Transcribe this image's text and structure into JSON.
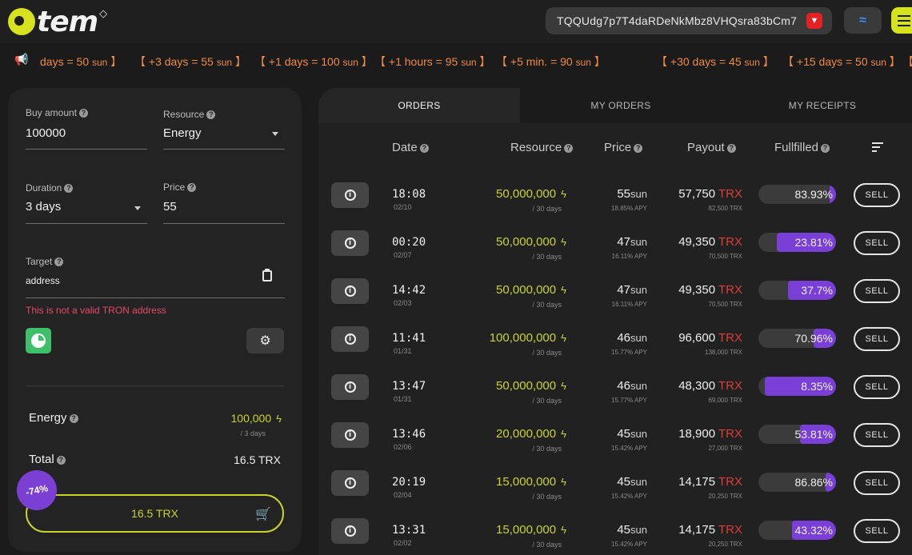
{
  "header": {
    "logo_text": "tem",
    "wallet_address": "TQQUdg7p7T4daRDeNkMbz8VHQsra83bCm7"
  },
  "ticker": [
    {
      "text": "days = 50 ",
      "unit": "sun",
      "end": " 】"
    },
    {
      "text": "【 +3 days = 55 ",
      "unit": "sun",
      "end": " 】"
    },
    {
      "text": "【 +1 days = 100 ",
      "unit": "sun",
      "end": " 】"
    },
    {
      "text": "【 +1 hours = 95 ",
      "unit": "sun",
      "end": " 】"
    },
    {
      "text": "【 +5 min. = 90 ",
      "unit": "sun",
      "end": " 】"
    },
    {
      "text": "【 +30 days = 45 ",
      "unit": "sun",
      "end": " 】"
    },
    {
      "text": "【 +15 days = 50 ",
      "unit": "sun",
      "end": " 】"
    },
    {
      "text": "【",
      "unit": "",
      "end": ""
    }
  ],
  "form": {
    "buy_amount_label": "Buy amount",
    "buy_amount_value": "100000",
    "resource_label": "Resource",
    "resource_value": "Energy",
    "duration_label": "Duration",
    "duration_value": "3 days",
    "price_label": "Price",
    "price_value": "55",
    "target_label": "Target",
    "target_value": "address",
    "error": "This is not a valid TRON address"
  },
  "summary": {
    "energy_label": "Energy",
    "energy_value": "100,000",
    "energy_sub": "/ 3 days",
    "total_label": "Total",
    "total_value": "16.5 TRX",
    "buy_button": "16.5 TRX",
    "discount": "-74%"
  },
  "tabs": [
    "ORDERS",
    "MY ORDERS",
    "MY RECEIPTS"
  ],
  "table": {
    "headers": [
      "Date",
      "Resource",
      "Price",
      "Payout",
      "Fullfilled"
    ],
    "rows": [
      {
        "time": "18:08",
        "date": "02/10",
        "resource": "50,000,000",
        "duration": "/ 30 days",
        "price": "55",
        "price_unit": "sun",
        "apy": "18.85% APY",
        "payout": "57,750",
        "payout_unit": "TRX",
        "payout_total": "82,500 TRX",
        "filled": "83.93%",
        "filled_frac": 0.08,
        "sell": "SELL"
      },
      {
        "time": "00:20",
        "date": "02/07",
        "resource": "50,000,000",
        "duration": "/ 30 days",
        "price": "47",
        "price_unit": "sun",
        "apy": "16.11% APY",
        "payout": "49,350",
        "payout_unit": "TRX",
        "payout_total": "70,500 TRX",
        "filled": "23.81%",
        "filled_frac": 0.76,
        "sell": "SELL"
      },
      {
        "time": "14:42",
        "date": "02/03",
        "resource": "50,000,000",
        "duration": "/ 30 days",
        "price": "47",
        "price_unit": "sun",
        "apy": "16.11% APY",
        "payout": "49,350",
        "payout_unit": "TRX",
        "payout_total": "70,500 TRX",
        "filled": "37.7%",
        "filled_frac": 0.62,
        "sell": "SELL"
      },
      {
        "time": "11:41",
        "date": "01/31",
        "resource": "100,000,000",
        "duration": "/ 30 days",
        "price": "46",
        "price_unit": "sun",
        "apy": "15.77% APY",
        "payout": "96,600",
        "payout_unit": "TRX",
        "payout_total": "138,000 TRX",
        "filled": "70.96%",
        "filled_frac": 0.29,
        "sell": "SELL"
      },
      {
        "time": "13:47",
        "date": "01/31",
        "resource": "50,000,000",
        "duration": "/ 30 days",
        "price": "46",
        "price_unit": "sun",
        "apy": "15.77% APY",
        "payout": "48,300",
        "payout_unit": "TRX",
        "payout_total": "69,000 TRX",
        "filled": "8.35%",
        "filled_frac": 0.92,
        "sell": "SELL"
      },
      {
        "time": "13:46",
        "date": "02/06",
        "resource": "20,000,000",
        "duration": "/ 30 days",
        "price": "45",
        "price_unit": "sun",
        "apy": "15.42% APY",
        "payout": "18,900",
        "payout_unit": "TRX",
        "payout_total": "27,000 TRX",
        "filled": "53.81%",
        "filled_frac": 0.46,
        "sell": "SELL"
      },
      {
        "time": "20:19",
        "date": "02/04",
        "resource": "15,000,000",
        "duration": "/ 30 days",
        "price": "45",
        "price_unit": "sun",
        "apy": "15.42% APY",
        "payout": "14,175",
        "payout_unit": "TRX",
        "payout_total": "20,250 TRX",
        "filled": "86.86%",
        "filled_frac": 0.13,
        "sell": "SELL"
      },
      {
        "time": "13:31",
        "date": "02/02",
        "resource": "15,000,000",
        "duration": "/ 30 days",
        "price": "45",
        "price_unit": "sun",
        "apy": "15.42% APY",
        "payout": "14,175",
        "payout_unit": "TRX",
        "payout_total": "20,250 TRX",
        "filled": "43.32%",
        "filled_frac": 0.57,
        "sell": "SELL"
      }
    ]
  }
}
